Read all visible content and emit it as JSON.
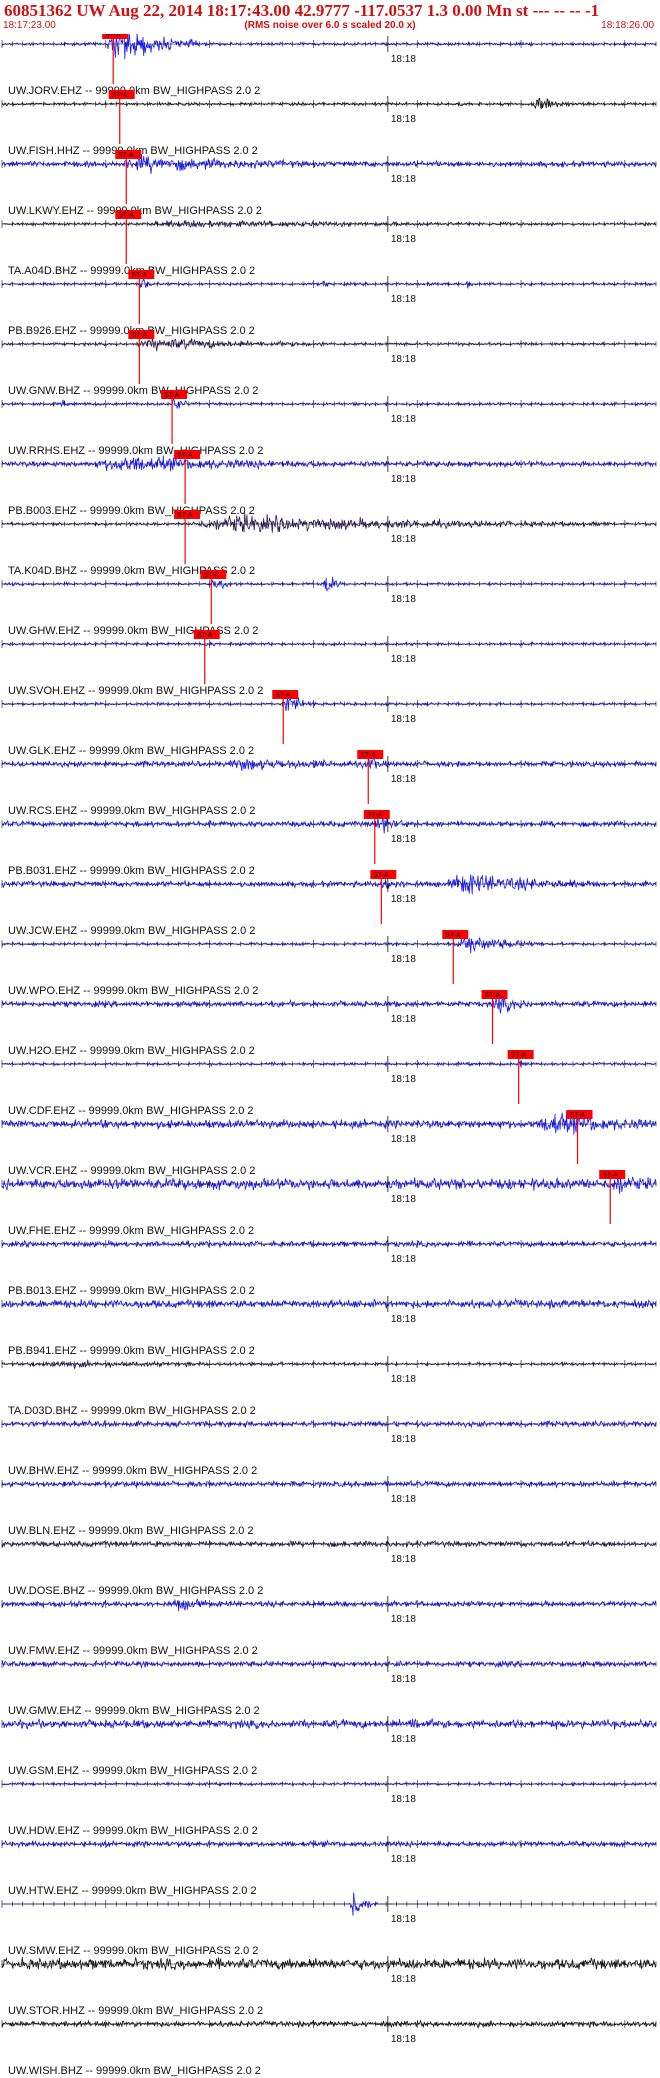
{
  "header": {
    "title": "60851362 UW Aug 22, 2014 18:17:43.00   42.9777 -117.0537  1.3 0.00 Mn st --- -- --   -1",
    "start_time": "18:17:23.00",
    "end_time": "18:18:26.00",
    "noise_note": "(RMS noise over 6.0 s scaled 20.0 x)"
  },
  "chart_data": {
    "type": "line",
    "title": "60851362 UW Aug 22, 2014 18:17:43.00   42.9777 -117.0537  1.3 0.00 Mn st --- -- --   -1",
    "xlabel": "",
    "ylabel": "",
    "xlim": [
      "18:17:23.00",
      "18:18:26.00"
    ],
    "minute_tick_label": "18:18",
    "pick_label": "ST-A",
    "colors": {
      "blue": "#1a1aff",
      "black": "#111111",
      "dark": "#2a1a5a",
      "pick": "#ff0000",
      "title": "#d01010"
    },
    "series": [
      {
        "name": "UW.JORV.EHZ -- 99999.0km BW_HIGHPASS  2.0  2",
        "color": "#1a1aff",
        "amp": 1,
        "pick": 0.17,
        "events": [
          {
            "at": 0.16,
            "len": 0.14,
            "amp": 14
          }
        ]
      },
      {
        "name": "UW.FISH.HHZ -- 99999.0km BW_HIGHPASS  2.0  2",
        "color": "#111111",
        "amp": 1,
        "pick": 0.18,
        "events": [
          {
            "at": 0.81,
            "len": 0.06,
            "amp": 7
          },
          {
            "at": 0.7,
            "len": 0.01,
            "amp": 4
          }
        ]
      },
      {
        "name": "UW.LKWY.EHZ -- 99999.0km BW_HIGHPASS  2.0  2",
        "color": "#1a1aff",
        "amp": 2,
        "pick": 0.19,
        "events": [
          {
            "at": 0.18,
            "len": 0.28,
            "amp": 5
          }
        ]
      },
      {
        "name": "TA.A04D.BHZ -- 99999.0km BW_HIGHPASS  2.0  2",
        "color": "#2a1a5a",
        "amp": 1,
        "pick": 0.19,
        "events": [
          {
            "at": 0.2,
            "len": 0.6,
            "amp": 2
          }
        ]
      },
      {
        "name": "PB.B926.EHZ -- 99999.0km BW_HIGHPASS  2.0  2",
        "color": "#1a1aff",
        "amp": 1,
        "pick": 0.21,
        "events": [
          {
            "at": 0.21,
            "len": 0.02,
            "amp": 9
          },
          {
            "at": 0.49,
            "len": 0.01,
            "amp": 6
          },
          {
            "at": 0.71,
            "len": 0.01,
            "amp": 5
          }
        ]
      },
      {
        "name": "UW.GNW.BHZ -- 99999.0km BW_HIGHPASS  2.0  2",
        "color": "#2a1a5a",
        "amp": 1,
        "pick": 0.21,
        "events": [
          {
            "at": 0.2,
            "len": 0.3,
            "amp": 4
          }
        ]
      },
      {
        "name": "UW.RRHS.EHZ -- 99999.0km BW_HIGHPASS  2.0  2",
        "color": "#1a1aff",
        "amp": 1,
        "pick": 0.26,
        "events": [
          {
            "at": 0.09,
            "len": 0.01,
            "amp": 4
          },
          {
            "at": 0.26,
            "len": 0.03,
            "amp": 6
          }
        ]
      },
      {
        "name": "PB.B003.EHZ -- 99999.0km BW_HIGHPASS  2.0  2",
        "color": "#1a1aff",
        "amp": 2,
        "pick": 0.28,
        "events": [
          {
            "at": 0.14,
            "len": 0.35,
            "amp": 5
          }
        ]
      },
      {
        "name": "TA.K04D.BHZ -- 99999.0km BW_HIGHPASS  2.0  2",
        "color": "#2a1a5a",
        "amp": 1,
        "pick": 0.28,
        "events": [
          {
            "at": 0.28,
            "len": 0.65,
            "amp": 6
          }
        ]
      },
      {
        "name": "UW.GHW.EHZ -- 99999.0km BW_HIGHPASS  2.0  2",
        "color": "#1a1aff",
        "amp": 1,
        "pick": 0.32,
        "events": [
          {
            "at": 0.32,
            "len": 0.04,
            "amp": 6
          },
          {
            "at": 0.49,
            "len": 0.03,
            "amp": 10
          }
        ]
      },
      {
        "name": "UW.SVOH.EHZ -- 99999.0km BW_HIGHPASS  2.0  2",
        "color": "#1a1aff",
        "amp": 1,
        "pick": 0.31,
        "events": [
          {
            "at": 0.31,
            "len": 0.02,
            "amp": 3
          }
        ]
      },
      {
        "name": "UW.GLK.EHZ -- 99999.0km BW_HIGHPASS  2.0  2",
        "color": "#1a1aff",
        "amp": 1,
        "pick": 0.43,
        "events": [
          {
            "at": 0.43,
            "len": 0.05,
            "amp": 8
          }
        ]
      },
      {
        "name": "UW.RCS.EHZ -- 99999.0km BW_HIGHPASS  2.0  2",
        "color": "#1a1aff",
        "amp": 2,
        "pick": 0.56,
        "events": [
          {
            "at": 0.34,
            "len": 0.25,
            "amp": 3
          },
          {
            "at": 0.56,
            "len": 0.02,
            "amp": 7
          }
        ]
      },
      {
        "name": "PB.B031.EHZ -- 99999.0km BW_HIGHPASS  2.0  2",
        "color": "#1a1aff",
        "amp": 2,
        "pick": 0.57,
        "events": [
          {
            "at": 0.57,
            "len": 0.05,
            "amp": 7
          }
        ]
      },
      {
        "name": "UW.JCW.EHZ -- 99999.0km BW_HIGHPASS  2.0  2",
        "color": "#1a1aff",
        "amp": 2,
        "pick": 0.58,
        "events": [
          {
            "at": 0.58,
            "len": 0.05,
            "amp": 4
          },
          {
            "at": 0.68,
            "len": 0.22,
            "amp": 7
          }
        ]
      },
      {
        "name": "UW.WPO.EHZ -- 99999.0km BW_HIGHPASS  2.0  2",
        "color": "#1a1aff",
        "amp": 1,
        "pick": 0.69,
        "events": [
          {
            "at": 0.69,
            "len": 0.14,
            "amp": 7
          }
        ]
      },
      {
        "name": "UW.H2O.EHZ -- 99999.0km BW_HIGHPASS  2.0  2",
        "color": "#1a1aff",
        "amp": 2,
        "pick": 0.75,
        "events": [
          {
            "at": 0.75,
            "len": 0.06,
            "amp": 6
          }
        ]
      },
      {
        "name": "UW.CDF.EHZ -- 99999.0km BW_HIGHPASS  2.0  2",
        "color": "#1a1aff",
        "amp": 1,
        "pick": 0.79,
        "events": [
          {
            "at": 0.79,
            "len": 0.02,
            "amp": 3
          }
        ]
      },
      {
        "name": "UW.VCR.EHZ -- 99999.0km BW_HIGHPASS  2.0  2",
        "color": "#1a1aff",
        "amp": 3,
        "pick": 0.88,
        "events": [
          {
            "at": 0.82,
            "len": 0.17,
            "amp": 7
          }
        ]
      },
      {
        "name": "UW.FHE.EHZ -- 99999.0km BW_HIGHPASS  2.0  2",
        "color": "#1a1aff",
        "amp": 4,
        "pick": 0.93,
        "events": [
          {
            "at": 0.93,
            "len": 0.05,
            "amp": 6
          }
        ]
      },
      {
        "name": "PB.B013.EHZ -- 99999.0km BW_HIGHPASS  2.0  2",
        "color": "#1a1aff",
        "amp": 2,
        "pick": null,
        "events": []
      },
      {
        "name": "PB.B941.EHZ -- 99999.0km BW_HIGHPASS  2.0  2",
        "color": "#1a1aff",
        "amp": 3,
        "pick": null,
        "events": []
      },
      {
        "name": "TA.D03D.BHZ -- 99999.0km BW_HIGHPASS  2.0  2",
        "color": "#2a1a5a",
        "amp": 1,
        "pick": null,
        "events": [
          {
            "at": 0.03,
            "len": 0.4,
            "amp": 2
          }
        ]
      },
      {
        "name": "UW.BHW.EHZ -- 99999.0km BW_HIGHPASS  2.0  2",
        "color": "#1a1aff",
        "amp": 2,
        "pick": null,
        "events": []
      },
      {
        "name": "UW.BLN.EHZ -- 99999.0km BW_HIGHPASS  2.0  2",
        "color": "#1a1aff",
        "amp": 2,
        "pick": null,
        "events": []
      },
      {
        "name": "UW.DOSE.BHZ -- 99999.0km BW_HIGHPASS  2.0  2",
        "color": "#2a1a5a",
        "amp": 2,
        "pick": null,
        "events": []
      },
      {
        "name": "UW.FMW.EHZ -- 99999.0km BW_HIGHPASS  2.0  2",
        "color": "#1a1aff",
        "amp": 2,
        "pick": null,
        "events": [
          {
            "at": 0.26,
            "len": 0.06,
            "amp": 4
          }
        ]
      },
      {
        "name": "UW.GMW.EHZ -- 99999.0km BW_HIGHPASS  2.0  2",
        "color": "#1a1aff",
        "amp": 2,
        "pick": null,
        "events": []
      },
      {
        "name": "UW.GSM.EHZ -- 99999.0km BW_HIGHPASS  2.0  2",
        "color": "#1a1aff",
        "amp": 3,
        "pick": null,
        "events": [
          {
            "at": 0.62,
            "len": 0.04,
            "amp": 4
          }
        ]
      },
      {
        "name": "UW.HDW.EHZ -- 99999.0km BW_HIGHPASS  2.0  2",
        "color": "#1a1aff",
        "amp": 1,
        "pick": null,
        "events": []
      },
      {
        "name": "UW.HTW.EHZ -- 99999.0km BW_HIGHPASS  2.0  2",
        "color": "#1a1aff",
        "amp": 2,
        "pick": null,
        "events": []
      },
      {
        "name": "UW.SMW.EHZ -- 99999.0km BW_HIGHPASS  2.0  2",
        "color": "#1a1aff",
        "amp": 0,
        "pick": null,
        "events": [
          {
            "at": 0.53,
            "len": 0.045,
            "amp": 14
          }
        ]
      },
      {
        "name": "UW.STOR.HHZ -- 99999.0km BW_HIGHPASS  2.0  2",
        "color": "#111111",
        "amp": 4,
        "pick": null,
        "events": []
      },
      {
        "name": "UW.WISH.BHZ -- 99999.0km BW_HIGHPASS  2.0  2",
        "color": "#111111",
        "amp": 2,
        "pick": null,
        "events": []
      }
    ]
  }
}
